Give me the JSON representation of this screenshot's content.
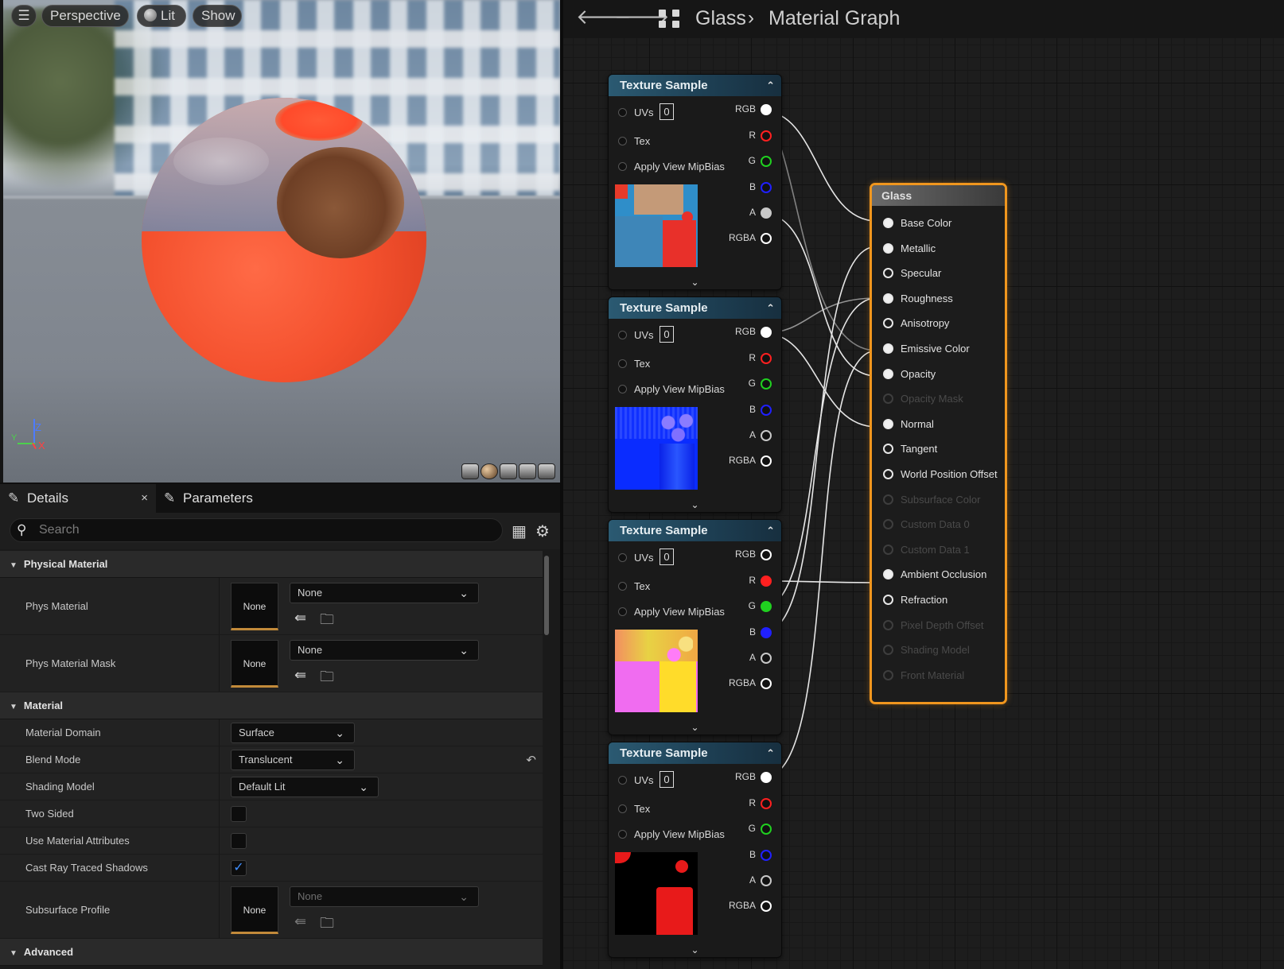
{
  "viewport": {
    "menu_icon": "hamburger-icon",
    "view_mode": "Perspective",
    "lighting": "Lit",
    "show": "Show",
    "axes": {
      "z": "Z",
      "x": "X",
      "y": "Y"
    }
  },
  "details": {
    "tabs": [
      {
        "label": "Details",
        "icon": "pencil-icon",
        "close": "×"
      },
      {
        "label": "Parameters",
        "icon": "pencil-icon"
      }
    ],
    "search_placeholder": "Search",
    "categories": {
      "physical": "Physical Material",
      "material": "Material",
      "advanced": "Advanced"
    },
    "rows": {
      "phys_material": {
        "label": "Phys Material",
        "thumb": "None",
        "value": "None"
      },
      "phys_material_mask": {
        "label": "Phys Material Mask",
        "thumb": "None",
        "value": "None"
      },
      "material_domain": {
        "label": "Material Domain",
        "value": "Surface"
      },
      "blend_mode": {
        "label": "Blend Mode",
        "value": "Translucent"
      },
      "shading_model": {
        "label": "Shading Model",
        "value": "Default Lit"
      },
      "two_sided": {
        "label": "Two Sided",
        "checked": false
      },
      "use_material_attributes": {
        "label": "Use Material Attributes",
        "checked": false
      },
      "cast_ray_traced_shadows": {
        "label": "Cast Ray Traced Shadows",
        "checked": true
      },
      "subsurface_profile": {
        "label": "Subsurface Profile",
        "thumb": "None",
        "value": "None"
      }
    }
  },
  "graph": {
    "breadcrumb": {
      "asset": "Glass",
      "separator": "›",
      "graph": "Material Graph"
    },
    "texture_nodes": [
      {
        "title": "Texture Sample",
        "uv_value": "0"
      },
      {
        "title": "Texture Sample",
        "uv_value": "0"
      },
      {
        "title": "Texture Sample",
        "uv_value": "0"
      },
      {
        "title": "Texture Sample",
        "uv_value": "0"
      }
    ],
    "node_inputs": [
      "UVs",
      "Tex",
      "Apply View MipBias"
    ],
    "node_outputs": [
      {
        "label": "RGB",
        "color": "#ffffff"
      },
      {
        "label": "R",
        "color": "#ff2020"
      },
      {
        "label": "G",
        "color": "#20d020"
      },
      {
        "label": "B",
        "color": "#2020ff"
      },
      {
        "label": "A",
        "color": "#c8c8c8"
      },
      {
        "label": "RGBA",
        "color": "#ffffff"
      }
    ],
    "glass_node": {
      "title": "Glass",
      "pins": [
        {
          "label": "Base Color",
          "state": "connected"
        },
        {
          "label": "Metallic",
          "state": "connected"
        },
        {
          "label": "Specular",
          "state": "open"
        },
        {
          "label": "Roughness",
          "state": "connected"
        },
        {
          "label": "Anisotropy",
          "state": "open"
        },
        {
          "label": "Emissive Color",
          "state": "connected"
        },
        {
          "label": "Opacity",
          "state": "connected"
        },
        {
          "label": "Opacity Mask",
          "state": "disabled"
        },
        {
          "label": "Normal",
          "state": "connected"
        },
        {
          "label": "Tangent",
          "state": "open"
        },
        {
          "label": "World Position Offset",
          "state": "open"
        },
        {
          "label": "Subsurface Color",
          "state": "disabled"
        },
        {
          "label": "Custom Data 0",
          "state": "disabled"
        },
        {
          "label": "Custom Data 1",
          "state": "disabled"
        },
        {
          "label": "Ambient Occlusion",
          "state": "connected"
        },
        {
          "label": "Refraction",
          "state": "open"
        },
        {
          "label": "Pixel Depth Offset",
          "state": "disabled"
        },
        {
          "label": "Shading Model",
          "state": "disabled"
        },
        {
          "label": "Front Material",
          "state": "disabled"
        }
      ]
    }
  }
}
